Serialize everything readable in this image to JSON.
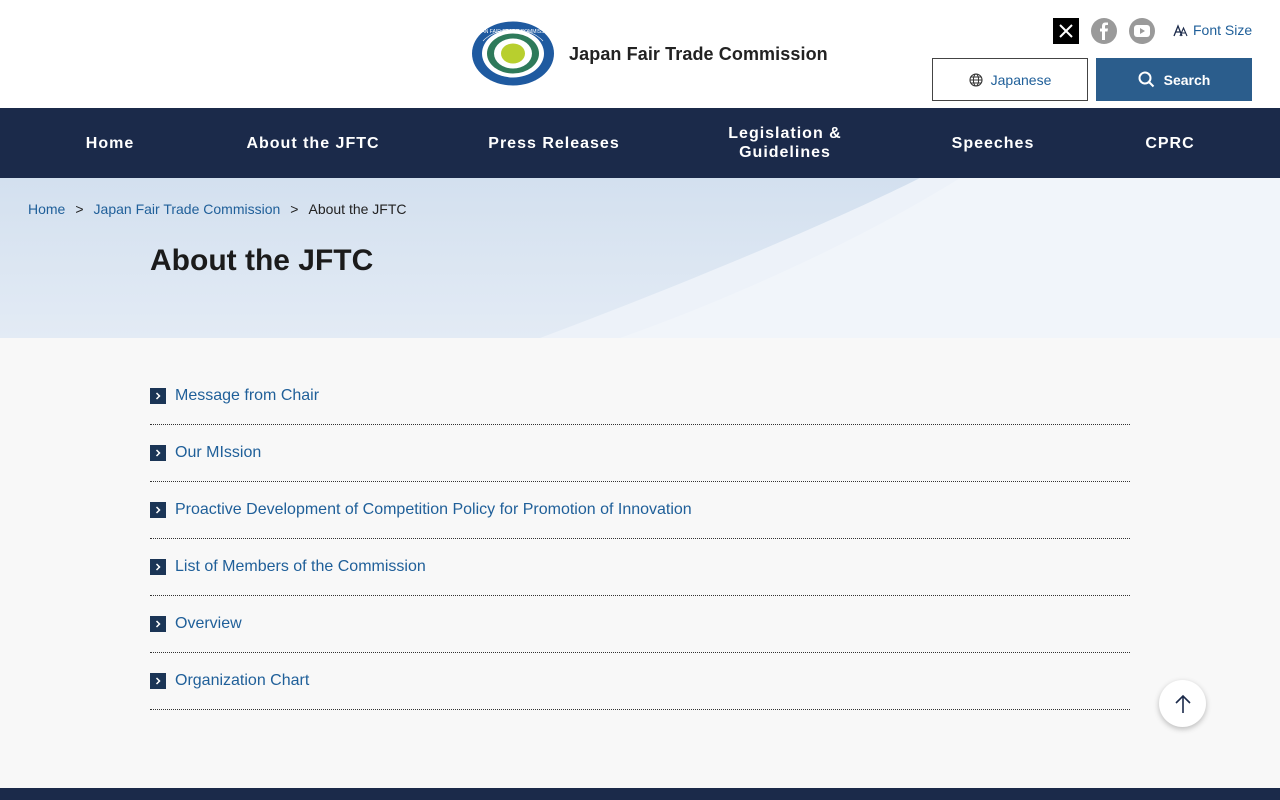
{
  "header": {
    "site_title": "Japan Fair Trade Commission",
    "logo_icon": "jftc-emblem",
    "logo_ring_text": "JAPAN FAIR TRADE COMMISSION",
    "social": [
      {
        "name": "x-icon",
        "color": "#000000"
      },
      {
        "name": "facebook-icon",
        "color": "#9a9a9a"
      },
      {
        "name": "youtube-icon",
        "color": "#9a9a9a"
      }
    ],
    "font_size_label": "Font Size",
    "language_button": "Japanese",
    "search_button": "Search"
  },
  "nav": {
    "items": [
      {
        "label": "Home"
      },
      {
        "label": "About the JFTC"
      },
      {
        "label": "Press Releases"
      },
      {
        "label": "Legislation &\nGuidelines"
      },
      {
        "label": "Speeches"
      },
      {
        "label": "CPRC"
      }
    ]
  },
  "breadcrumb": {
    "items": [
      {
        "label": "Home"
      },
      {
        "label": "Japan Fair Trade Commission"
      },
      {
        "label": "About the JFTC"
      }
    ],
    "separator": ">"
  },
  "page": {
    "title": "About the JFTC"
  },
  "links": [
    {
      "label": "Message from Chair"
    },
    {
      "label": "Our MIssion"
    },
    {
      "label": "Proactive Development of Competition Policy for Promotion of Innovation"
    },
    {
      "label": "List of Members of the Commission"
    },
    {
      "label": "Overview"
    },
    {
      "label": "Organization Chart"
    }
  ],
  "colors": {
    "nav_background": "#1b2a4a",
    "link": "#1f5f99",
    "search_button": "#2b5d8c",
    "chevron_box": "#1b3556"
  }
}
